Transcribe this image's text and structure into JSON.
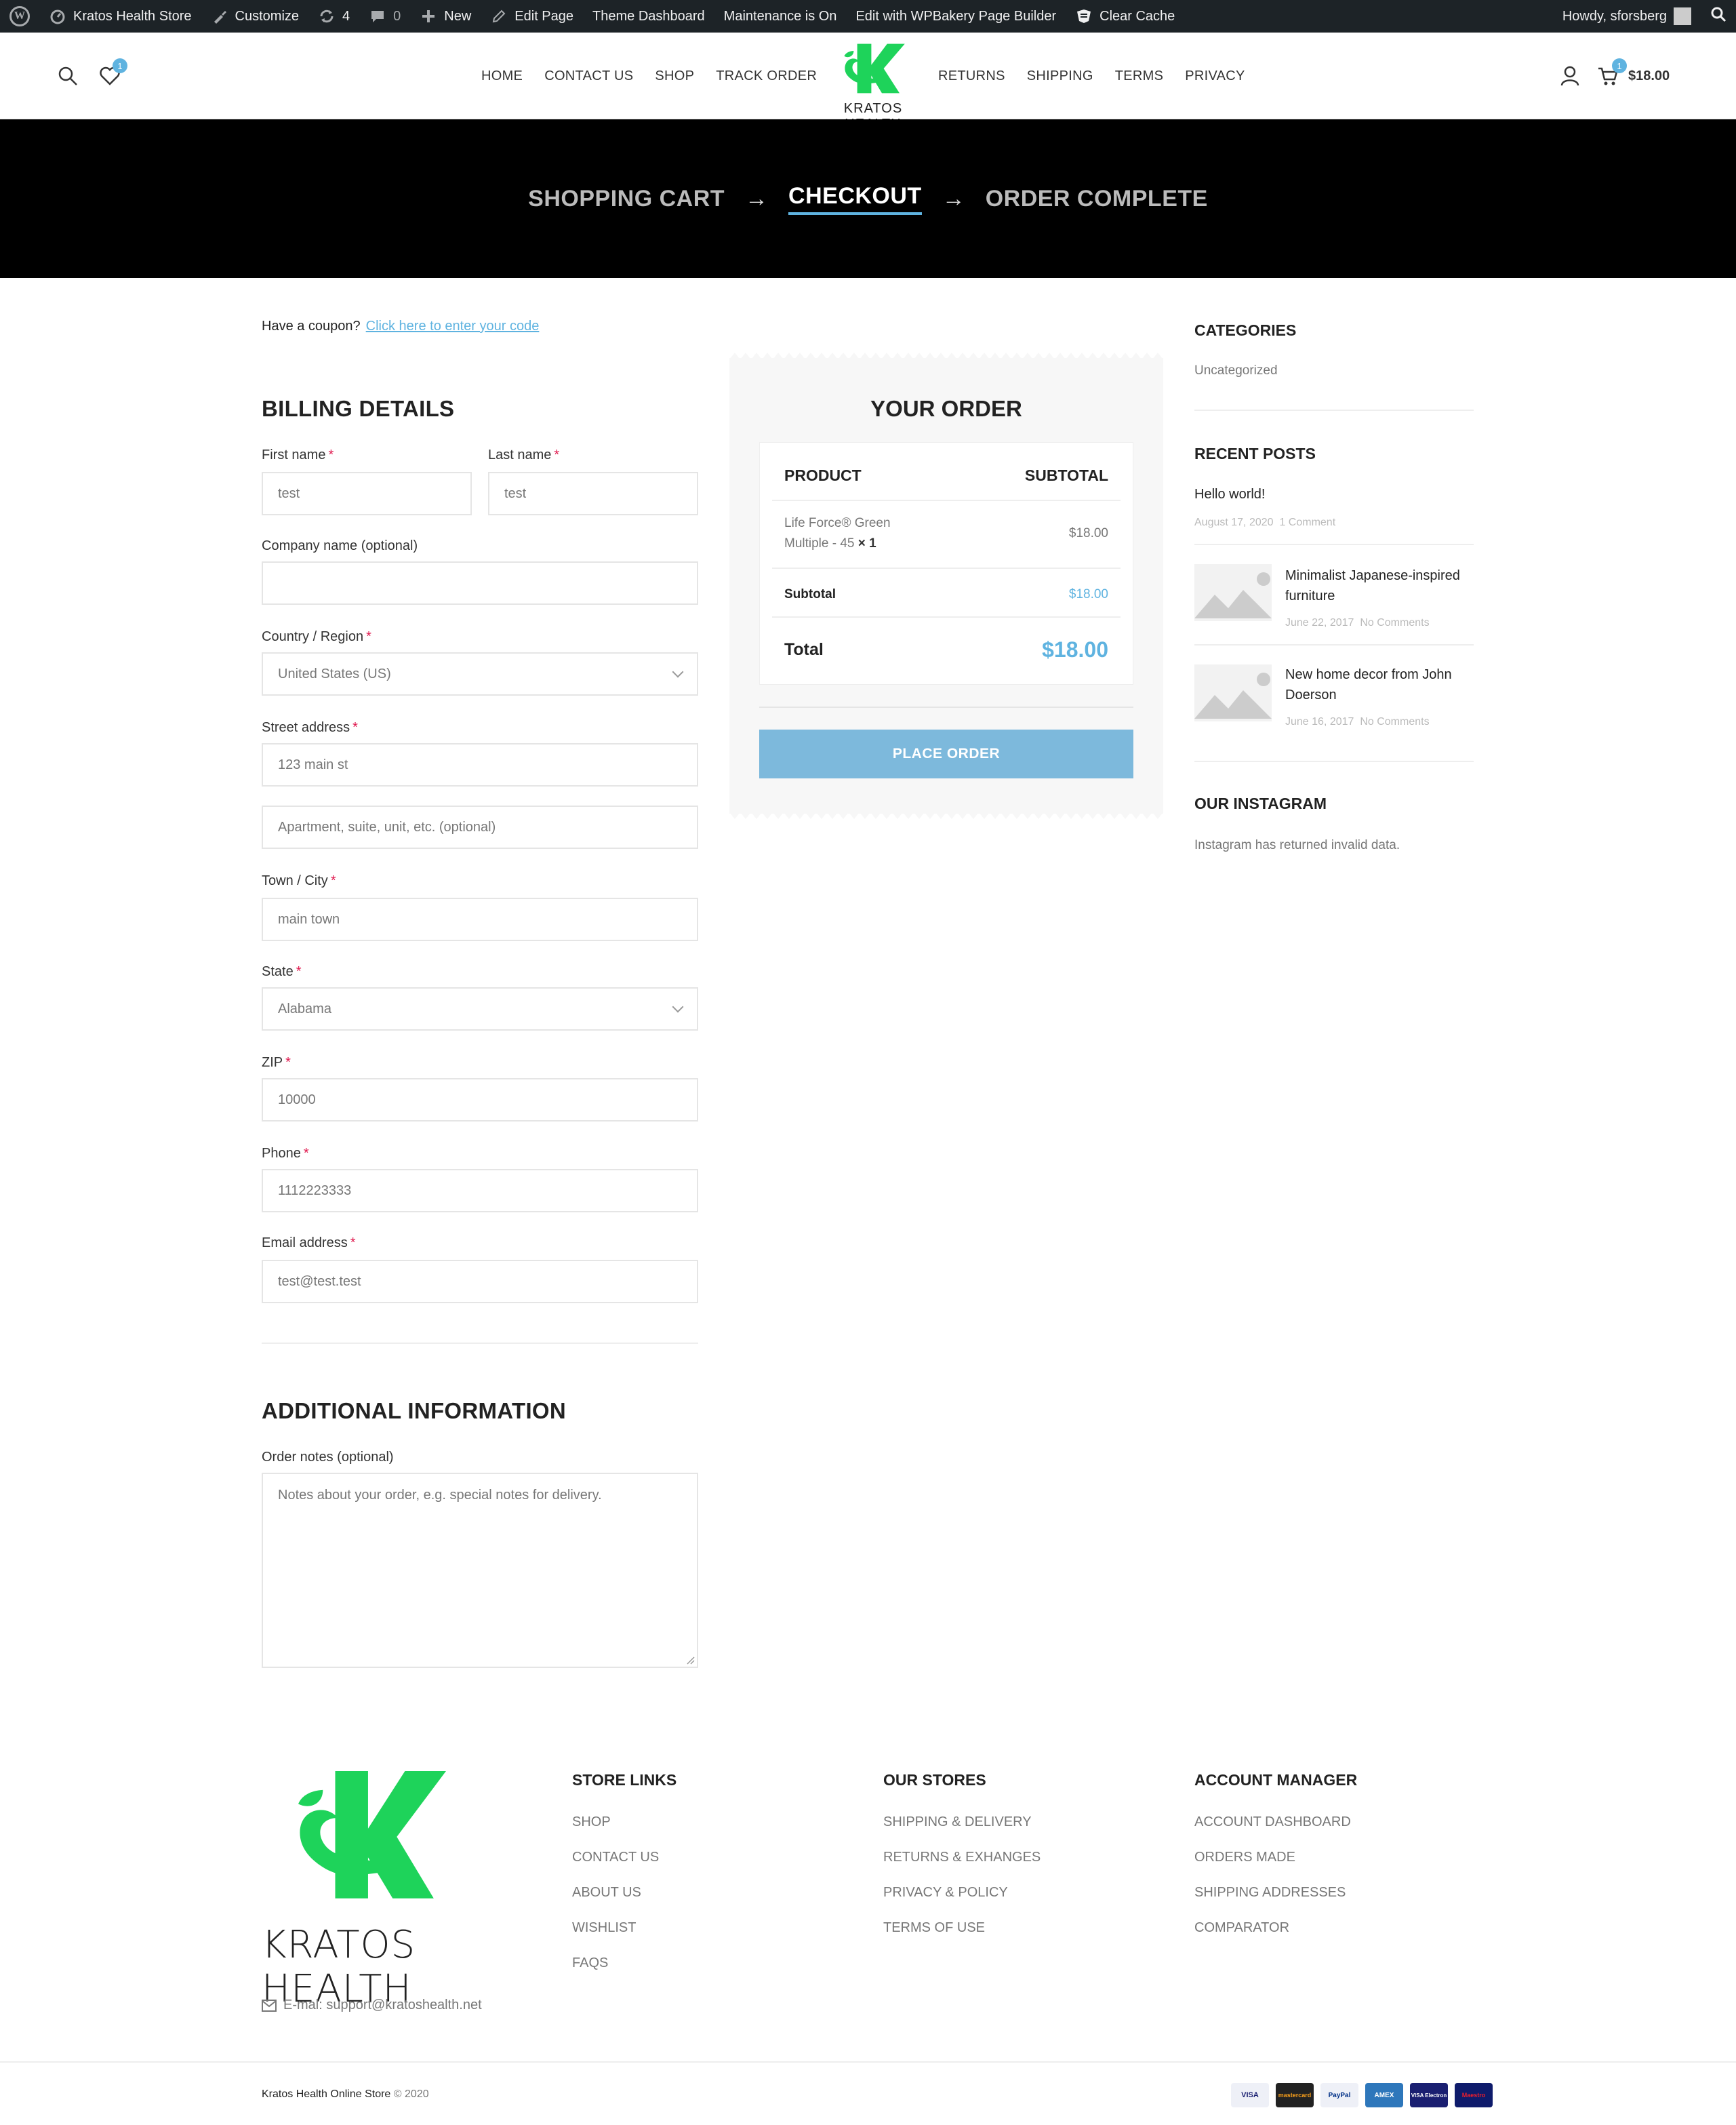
{
  "adminbar": {
    "site": "Kratos Health Store",
    "customize": "Customize",
    "updates": "4",
    "comments": "0",
    "new": "New",
    "edit_page": "Edit Page",
    "theme_dashboard": "Theme Dashboard",
    "maintenance": "Maintenance is On",
    "wpbakery": "Edit with WPBakery Page Builder",
    "clear_cache": "Clear Cache",
    "howdy": "Howdy, sforsberg"
  },
  "header": {
    "wishlist_count": "1",
    "cart_count": "1",
    "cart_total": "$18.00",
    "logo_text": "KRATOS HEALTH",
    "nav_left": [
      "HOME",
      "CONTACT US",
      "SHOP",
      "TRACK ORDER"
    ],
    "nav_right": [
      "RETURNS",
      "SHIPPING",
      "TERMS",
      "PRIVACY"
    ]
  },
  "steps": {
    "cart": "SHOPPING CART",
    "checkout": "CHECKOUT",
    "complete": "ORDER COMPLETE",
    "arrow": "→"
  },
  "coupon": {
    "text": "Have a coupon?",
    "link": "Click here to enter your code"
  },
  "billing": {
    "title": "BILLING DETAILS",
    "first_name_label": "First name",
    "first_name": "test",
    "last_name_label": "Last name",
    "last_name": "test",
    "company_label": "Company name (optional)",
    "company": "",
    "country_label": "Country / Region",
    "country": "United States (US)",
    "street_label": "Street address",
    "street": "123 main st",
    "apartment_placeholder": "Apartment, suite, unit, etc. (optional)",
    "town_label": "Town / City",
    "town": "main town",
    "state_label": "State",
    "state": "Alabama",
    "zip_label": "ZIP",
    "zip": "10000",
    "phone_label": "Phone",
    "phone": "1112223333",
    "email_label": "Email address",
    "email": "test@test.test",
    "required": "*"
  },
  "additional": {
    "title": "ADDITIONAL INFORMATION",
    "notes_label": "Order notes (optional)",
    "notes_placeholder": "Notes about your order, e.g. special notes for delivery."
  },
  "order": {
    "title": "YOUR ORDER",
    "col_product": "PRODUCT",
    "col_subtotal": "SUBTOTAL",
    "item_name_1": "Life Force® Green",
    "item_name_2": "Multiple - 45",
    "item_qty": "× 1",
    "item_price": "$18.00",
    "subtotal_label": "Subtotal",
    "subtotal": "$18.00",
    "total_label": "Total",
    "total": "$18.00",
    "place_order": "PLACE ORDER"
  },
  "sidebar": {
    "categories_title": "CATEGORIES",
    "category": "Uncategorized",
    "recent_title": "RECENT POSTS",
    "post1_title": "Hello world!",
    "post1_date": "August 17, 2020",
    "post1_comments": "1 Comment",
    "post2_title_1": "Minimalist Japanese-inspired",
    "post2_title_2": "furniture",
    "post2_date": "June 22, 2017",
    "post2_comments": "No Comments",
    "post3_title_1": "New home decor from John",
    "post3_title_2": "Doerson",
    "post3_date": "June 16, 2017",
    "post3_comments": "No Comments",
    "instagram_title": "OUR INSTAGRAM",
    "instagram_msg": "Instagram has returned invalid data."
  },
  "footer": {
    "logo_text": "KRATOS HEALTH",
    "email": "E-mal: support@kratoshealth.net",
    "store_links_title": "STORE LINKS",
    "store_links": [
      "SHOP",
      "CONTACT US",
      "ABOUT US",
      "WISHLIST",
      "FAQS"
    ],
    "our_stores_title": "OUR STORES",
    "our_stores": [
      "SHIPPING & DELIVERY",
      "RETURNS & EXHANGES",
      "PRIVACY & POLICY",
      "TERMS OF USE"
    ],
    "account_title": "ACCOUNT MANAGER",
    "account_links": [
      "ACCOUNT DASHBOARD",
      "ORDERS MADE",
      "SHIPPING ADDRESSES",
      "COMPARATOR"
    ],
    "copyright_store": "Kratos Health Online Store",
    "copyright_year": "© 2020",
    "payments": [
      "VISA",
      "mastercard",
      "PayPal",
      "AMEX",
      "VISA Electron",
      "Maestro"
    ]
  },
  "colors": {
    "brand_green": "#1ed35a",
    "accent_blue": "#5fb3e0",
    "adminbar": "#1d2327",
    "hero": "#000000"
  }
}
